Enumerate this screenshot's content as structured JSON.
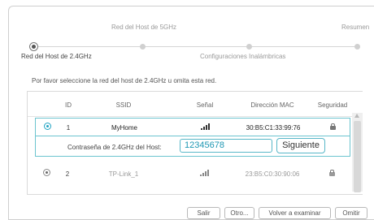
{
  "wizard": {
    "steps": [
      {
        "label": "Red del Host de 2.4GHz",
        "state": "current"
      },
      {
        "label": "Red del Host de 5GHz",
        "state": "pending"
      },
      {
        "label": "Configuraciones Inalámbricas",
        "state": "pending"
      },
      {
        "label": "Resumen",
        "state": "pending"
      }
    ]
  },
  "instruction": "Por favor seleccione la red del host de 2.4GHz u omita esta red.",
  "table": {
    "headers": {
      "id": "ID",
      "ssid": "SSID",
      "signal": "Señal",
      "mac": "Dirección MAC",
      "security": "Seguridad"
    },
    "rows": [
      {
        "id": "1",
        "ssid": "MyHome",
        "mac": "30:B5:C1:33:99:76",
        "selected": true,
        "secured": true,
        "signal_level": 4
      },
      {
        "id": "2",
        "ssid": "TP-Link_1",
        "mac": "23:B5:C0:30:90:06",
        "selected": false,
        "secured": true,
        "signal_level": 3
      }
    ]
  },
  "password": {
    "label": "Contraseña de 2.4GHz del Host:",
    "value": "12345678",
    "next_label": "Siguiente"
  },
  "footer": {
    "exit_label": "Salir",
    "other_label": "Otro...",
    "rescan_label": "Volver a examinar",
    "skip_label": "Omitir"
  },
  "colors": {
    "accent": "#1fa3c2",
    "border_accent": "#58b7c8"
  }
}
